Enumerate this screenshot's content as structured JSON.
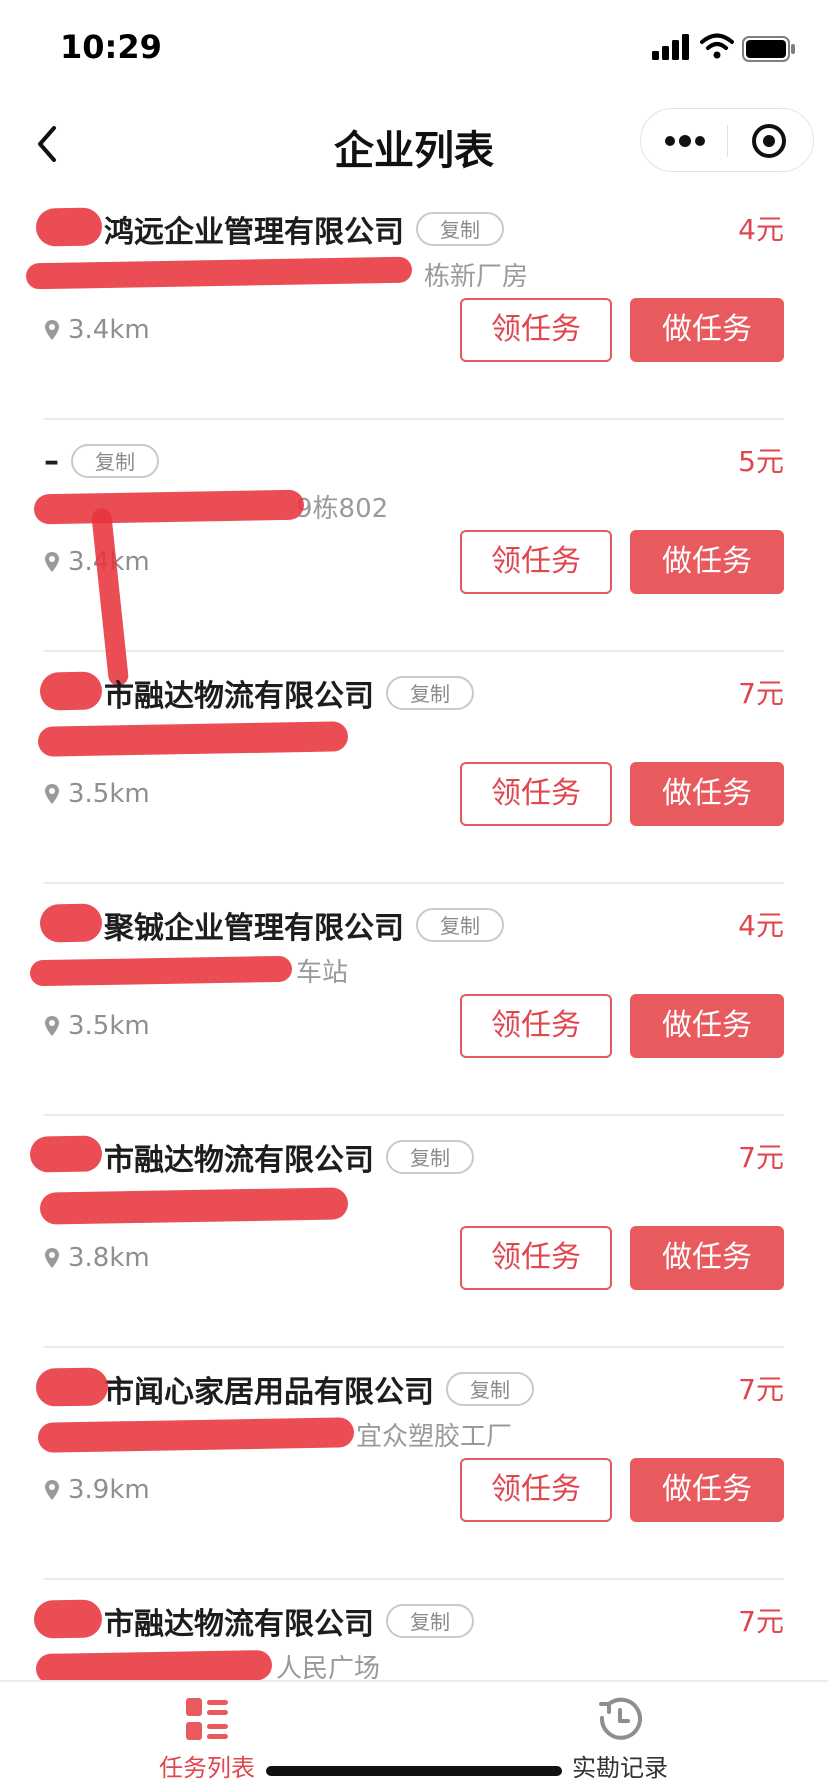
{
  "status_bar": {
    "time": "10:29"
  },
  "nav": {
    "title": "企业列表"
  },
  "cards": [
    {
      "company": "鸿远企业管理有限公司",
      "copy_label": "复制",
      "price": "4元",
      "address": "栋新厂房",
      "distance": "3.4km",
      "claim_label": "领任务",
      "do_label": "做任务"
    },
    {
      "company": "–",
      "copy_label": "复制",
      "price": "5元",
      "address": "9栋802",
      "distance": "3.4km",
      "claim_label": "领任务",
      "do_label": "做任务"
    },
    {
      "company": "市融达物流有限公司",
      "copy_label": "复制",
      "price": "7元",
      "address": "",
      "distance": "3.5km",
      "claim_label": "领任务",
      "do_label": "做任务"
    },
    {
      "company": "聚铖企业管理有限公司",
      "copy_label": "复制",
      "price": "4元",
      "address": "车站",
      "distance": "3.5km",
      "claim_label": "领任务",
      "do_label": "做任务"
    },
    {
      "company": "市融达物流有限公司",
      "copy_label": "复制",
      "price": "7元",
      "address": "",
      "distance": "3.8km",
      "claim_label": "领任务",
      "do_label": "做任务"
    },
    {
      "company": "市闻心家居用品有限公司",
      "copy_label": "复制",
      "price": "7元",
      "address": "宜众塑胶工厂",
      "distance": "3.9km",
      "claim_label": "领任务",
      "do_label": "做任务"
    },
    {
      "company": "市融达物流有限公司",
      "copy_label": "复制",
      "price": "7元",
      "address": "人民广场",
      "distance": "",
      "claim_label": "",
      "do_label": ""
    }
  ],
  "tab_bar": {
    "tasks_label": "任务列表",
    "records_label": "实勘记录",
    "active_color": "#e0464d"
  },
  "colors": {
    "accent": "#e85a5e",
    "price": "#e0464d"
  }
}
